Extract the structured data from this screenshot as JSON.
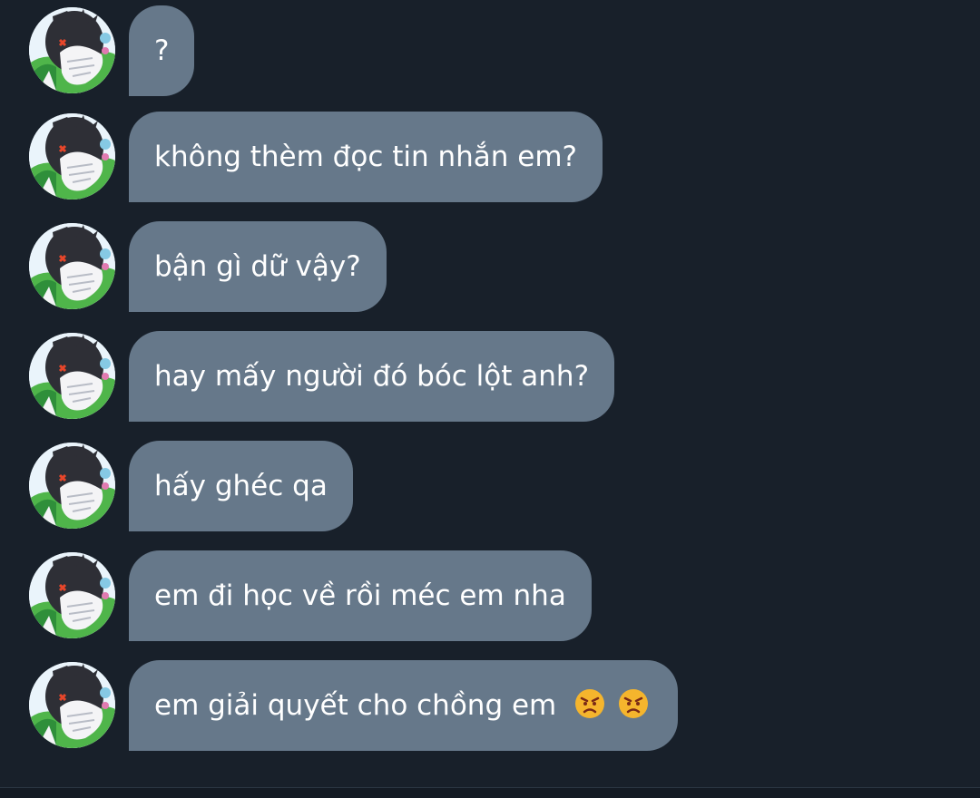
{
  "messages": [
    {
      "text": "?"
    },
    {
      "text": "không thèm đọc tin nhắn em?"
    },
    {
      "text": "bận gì dữ vậy?"
    },
    {
      "text": "hay mấy người đó bóc lột anh?"
    },
    {
      "text": "hấy ghéc qa"
    },
    {
      "text": "em đi học về rồi méc em nha"
    },
    {
      "text": "em giải quyết cho chồng em",
      "emojis": [
        "angry-face-emoji",
        "angry-face-emoji"
      ]
    }
  ],
  "colors": {
    "background": "#18202a",
    "bubble": "#66788a",
    "text": "#ffffff",
    "emoji_face": "#f5b52d",
    "emoji_mouth": "#7a2a16"
  },
  "avatar_icon": "anime-character-avatar"
}
